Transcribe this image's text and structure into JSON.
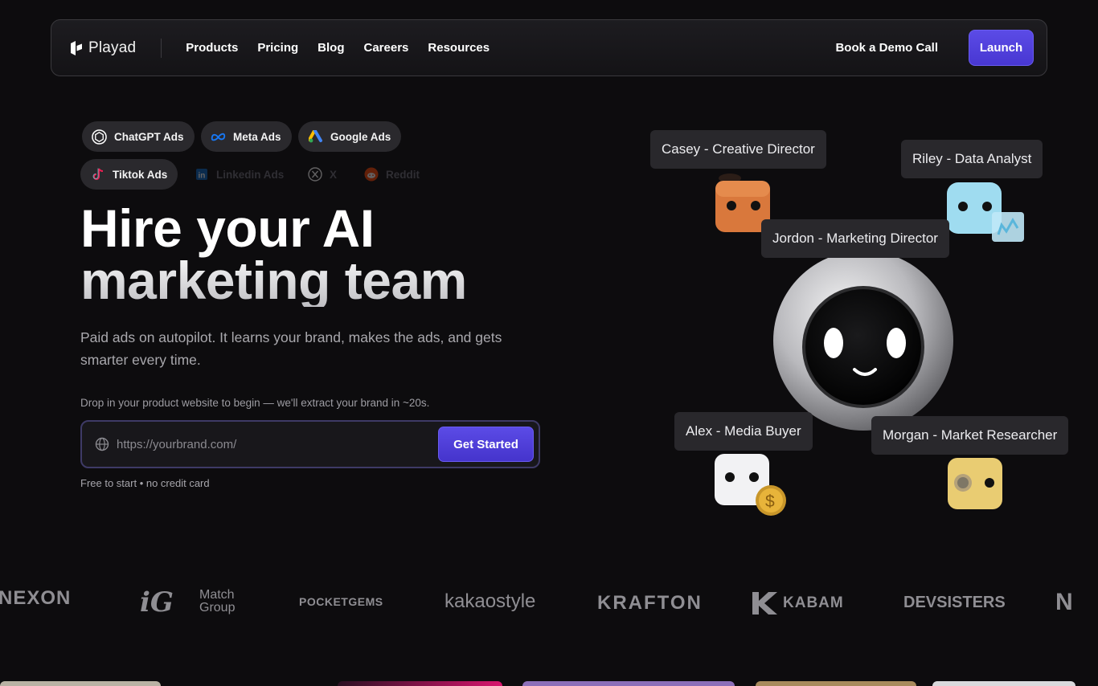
{
  "nav": {
    "brand": "Playad",
    "links": [
      "Products",
      "Pricing",
      "Blog",
      "Careers",
      "Resources"
    ],
    "demo": "Book a Demo Call",
    "launch": "Launch"
  },
  "platforms": [
    {
      "label": "ChatGPT Ads",
      "icon": "chatgpt-icon"
    },
    {
      "label": "Meta Ads",
      "icon": "meta-icon"
    },
    {
      "label": "Google Ads",
      "icon": "google-ads-icon"
    },
    {
      "label": "Tiktok Ads",
      "icon": "tiktok-icon"
    },
    {
      "label": "Linkedin Ads",
      "icon": "linkedin-icon"
    },
    {
      "label": "X",
      "icon": "x-icon"
    },
    {
      "label": "Reddit",
      "icon": "reddit-icon"
    }
  ],
  "hero": {
    "title_line1": "Hire your AI",
    "title_line2": "marketing team",
    "subtitle": "Paid ads on autopilot. It learns your brand, makes the ads, and gets smarter every time.",
    "hint": "Drop in your product website to begin — we'll extract your brand in ~20s.",
    "url_placeholder": "https://yourbrand.com/",
    "cta": "Get Started",
    "note": "Free to start • no credit card"
  },
  "agents": [
    {
      "label": "Casey - Creative Director"
    },
    {
      "label": "Riley - Data Analyst"
    },
    {
      "label": "Jordon - Marketing Director"
    },
    {
      "label": "Alex - Media Buyer"
    },
    {
      "label": "Morgan - Market Researcher"
    }
  ],
  "logos": [
    "NEXON",
    "Match Group",
    "POCKETGEMS",
    "kakaostyle",
    "KRAFTON",
    "KABAM",
    "DEVSISTERS",
    "N"
  ],
  "colors": {
    "accent": "#5b4be6",
    "background": "#0d0c0e",
    "chip": "#2a292d",
    "tag": "#29282c"
  }
}
